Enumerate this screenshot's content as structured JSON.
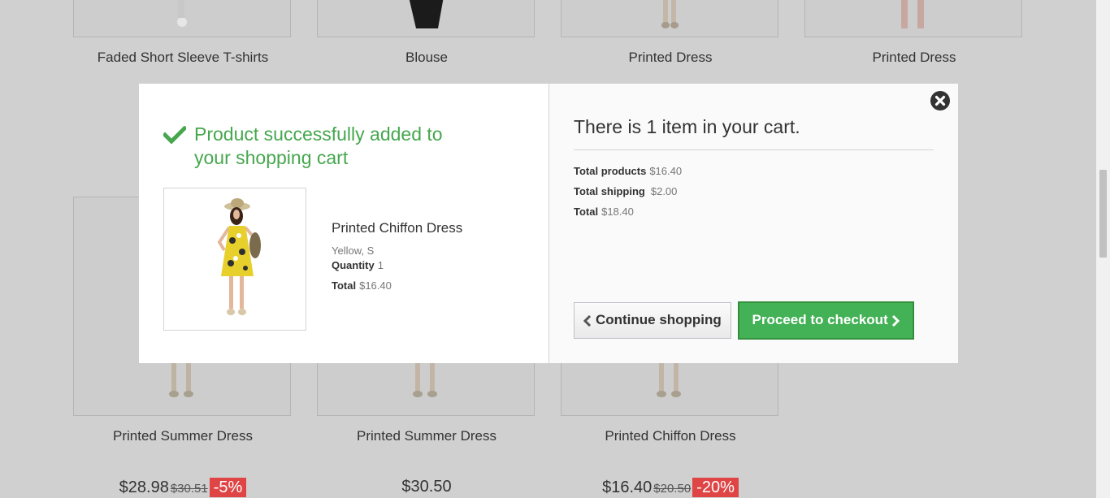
{
  "top_row": [
    {
      "name": "Faded Short Sleeve T-shirts"
    },
    {
      "name": "Blouse"
    },
    {
      "name": "Printed Dress"
    },
    {
      "name": "Printed Dress"
    }
  ],
  "bottom_row": [
    {
      "name": "Printed Summer Dress",
      "price": "$28.98",
      "old_price": "$30.51",
      "reduction": "-5%"
    },
    {
      "name": "Printed Summer Dress",
      "price": "$30.50"
    },
    {
      "name": "Printed Chiffon Dress",
      "price": "$16.40",
      "old_price": "$20.50",
      "reduction": "-20%"
    }
  ],
  "modal": {
    "success_message": "Product successfully added to your shopping cart",
    "product": {
      "name": "Printed Chiffon Dress",
      "attributes": "Yellow, S",
      "quantity_label": "Quantity",
      "quantity": "1",
      "total_label": "Total",
      "total": "$16.40"
    },
    "cart": {
      "title": "There is 1 item in your cart.",
      "total_products_label": "Total products",
      "total_products": "$16.40",
      "total_shipping_label": "Total shipping",
      "total_shipping": "$2.00",
      "total_label": "Total",
      "total": "$18.40"
    },
    "continue_label": "Continue shopping",
    "checkout_label": "Proceed to checkout"
  },
  "colors": {
    "success_green": "#46a74e",
    "checkout_button": "#43b155",
    "reduction_badge": "#e04545"
  },
  "icons": [
    "check-icon",
    "close-icon",
    "chevron-left-icon",
    "chevron-right-icon"
  ]
}
